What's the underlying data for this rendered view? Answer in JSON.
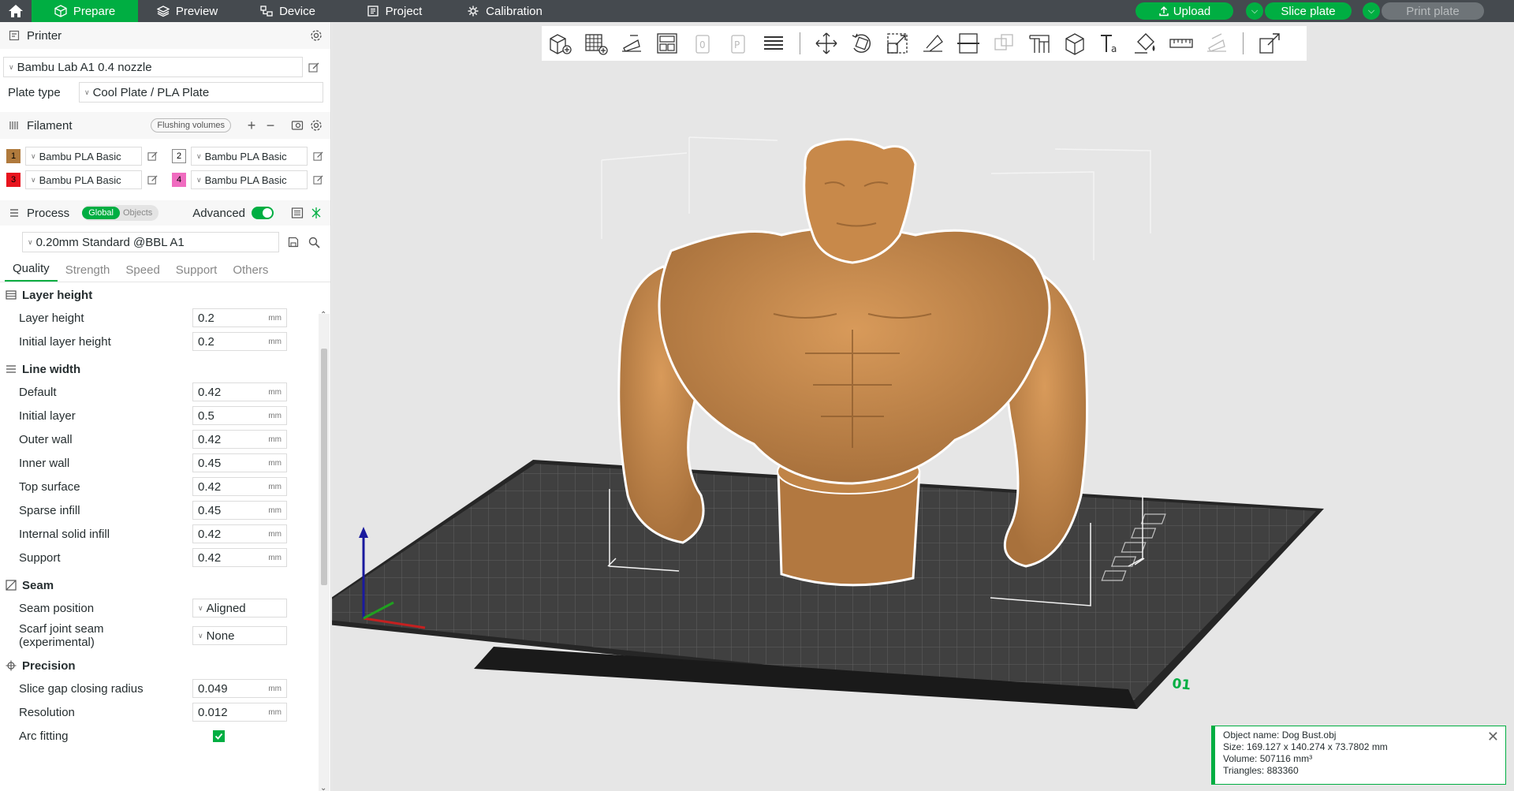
{
  "nav": {
    "tabs": [
      {
        "label": "Prepare",
        "icon": "cube-icon"
      },
      {
        "label": "Preview",
        "icon": "layers-icon"
      },
      {
        "label": "Device",
        "icon": "device-icon"
      },
      {
        "label": "Project",
        "icon": "project-icon"
      },
      {
        "label": "Calibration",
        "icon": "calibration-icon"
      }
    ],
    "upload": "Upload",
    "slice": "Slice plate",
    "print": "Print plate"
  },
  "printer": {
    "title": "Printer",
    "name": "Bambu Lab A1 0.4 nozzle",
    "plate_label": "Plate type",
    "plate": "Cool Plate / PLA Plate"
  },
  "filament": {
    "title": "Filament",
    "flush": "Flushing volumes",
    "items": [
      {
        "num": "1",
        "name": "Bambu PLA Basic",
        "color": "#b07a3c"
      },
      {
        "num": "2",
        "name": "Bambu PLA Basic",
        "color": "#ffffff"
      },
      {
        "num": "3",
        "name": "Bambu PLA Basic",
        "color": "#e8141e"
      },
      {
        "num": "4",
        "name": "Bambu PLA Basic",
        "color": "#f06cc0"
      }
    ]
  },
  "process": {
    "title": "Process",
    "global": "Global",
    "objects": "Objects",
    "advanced": "Advanced",
    "preset": "0.20mm Standard @BBL A1",
    "tabs": [
      "Quality",
      "Strength",
      "Speed",
      "Support",
      "Others"
    ]
  },
  "quality": {
    "layer_height": {
      "title": "Layer height",
      "rows": [
        {
          "label": "Layer height",
          "value": "0.2",
          "unit": "mm"
        },
        {
          "label": "Initial layer height",
          "value": "0.2",
          "unit": "mm"
        }
      ]
    },
    "line_width": {
      "title": "Line width",
      "rows": [
        {
          "label": "Default",
          "value": "0.42",
          "unit": "mm"
        },
        {
          "label": "Initial layer",
          "value": "0.5",
          "unit": "mm"
        },
        {
          "label": "Outer wall",
          "value": "0.42",
          "unit": "mm"
        },
        {
          "label": "Inner wall",
          "value": "0.45",
          "unit": "mm"
        },
        {
          "label": "Top surface",
          "value": "0.42",
          "unit": "mm"
        },
        {
          "label": "Sparse infill",
          "value": "0.45",
          "unit": "mm"
        },
        {
          "label": "Internal solid infill",
          "value": "0.42",
          "unit": "mm"
        },
        {
          "label": "Support",
          "value": "0.42",
          "unit": "mm"
        }
      ]
    },
    "seam": {
      "title": "Seam",
      "position_label": "Seam position",
      "position_value": "Aligned",
      "scarf_label": "Scarf joint seam",
      "scarf_label2": "(experimental)",
      "scarf_value": "None"
    },
    "precision": {
      "title": "Precision",
      "rows": [
        {
          "label": "Slice gap closing radius",
          "value": "0.049",
          "unit": "mm"
        },
        {
          "label": "Resolution",
          "value": "0.012",
          "unit": "mm"
        }
      ],
      "arc_label": "Arc fitting"
    }
  },
  "info": {
    "name": "Object name: Dog Bust.obj",
    "size": "Size: 169.127 x 140.274 x 73.7802 mm",
    "volume": "Volume: 507116 mm³",
    "triangles": "Triangles: 883360"
  },
  "plate_number": "01",
  "colors": {
    "accent": "#00ae42",
    "model": "#c8894a",
    "bed": "#3a3a3a"
  }
}
